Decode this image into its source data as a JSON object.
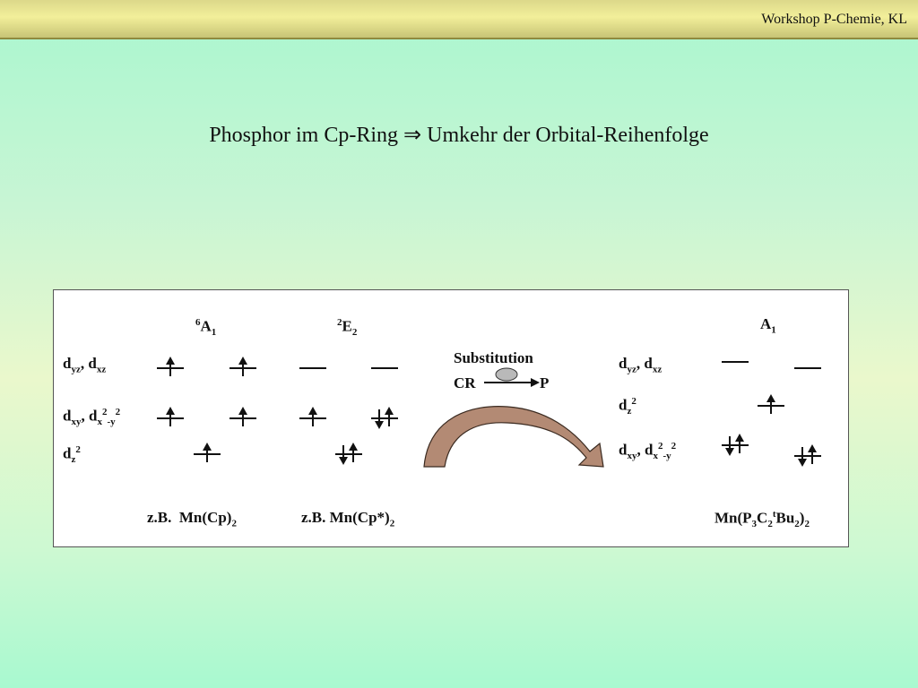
{
  "header": {
    "title": "Workshop P-Chemie, KL"
  },
  "slide": {
    "title": "Phosphor im Cp-Ring  ⇒ Umkehr der Orbital-Reihenfolge"
  },
  "diagram": {
    "left_labels": {
      "dyz_dxz": {
        "d1": "d",
        "s1": "yz",
        "sep": ", d",
        "s2": "xz"
      },
      "dxy_dx2y2": {
        "d1": "d",
        "s1": "xy",
        "sep": ", d",
        "s2": "x",
        "p1": "2",
        "m": "-y",
        "p2": "2"
      },
      "dz2": {
        "d": "d",
        "s": "z",
        "p": "2"
      }
    },
    "terms": {
      "sextet": {
        "sup": "6",
        "main": "A",
        "sub": "1"
      },
      "doublet": {
        "sup": "2",
        "main": "E",
        "sub": "2"
      },
      "right": {
        "main": "A",
        "sub": "1"
      }
    },
    "substitution": {
      "title": "Substitution",
      "from": "CR",
      "to": "P"
    },
    "right_labels": {
      "dyz_dxz": {
        "d1": "d",
        "s1": "yz",
        "sep": ", d",
        "s2": "xz"
      },
      "dz2": {
        "d": "d",
        "s": "z",
        "p": "2"
      },
      "dxy_dx2y2": {
        "d1": "d",
        "s1": "xy",
        "sep": ", d",
        "s2": "x",
        "p1": "2",
        "m": "-y",
        "p2": "2"
      }
    },
    "examples": {
      "ex1": {
        "prefix": "z.B.",
        "formula": "Mn(Cp)",
        "sub": "2"
      },
      "ex2": {
        "prefix": "z.B.",
        "formula": "Mn(Cp*)",
        "sub": "2"
      },
      "ex3": {
        "a": "Mn(P",
        "s1": "3",
        "b": "C",
        "s2": "2",
        "sup": "t",
        "c": "Bu",
        "s3": "2",
        "d": ")",
        "s4": "2"
      }
    },
    "colors": {
      "curved_arrow_fill": "#b38a74",
      "curved_arrow_stroke": "#3a2a20",
      "ellipse_fill": "#b9b9b9"
    },
    "electron_configs": {
      "sextet": {
        "dyz_dxz": [
          "up",
          "up"
        ],
        "dxy_dx2y2": [
          "up",
          "up"
        ],
        "dz2": [
          "up"
        ]
      },
      "doublet": {
        "dyz_dxz": [
          "empty",
          "empty"
        ],
        "dxy_dx2y2": [
          "up",
          "paired"
        ],
        "dz2": [
          "paired"
        ]
      },
      "right": {
        "dyz_dxz": [
          "empty",
          "empty"
        ],
        "dz2": [
          "up"
        ],
        "dxy_dx2y2": [
          "paired",
          "paired"
        ]
      }
    }
  }
}
